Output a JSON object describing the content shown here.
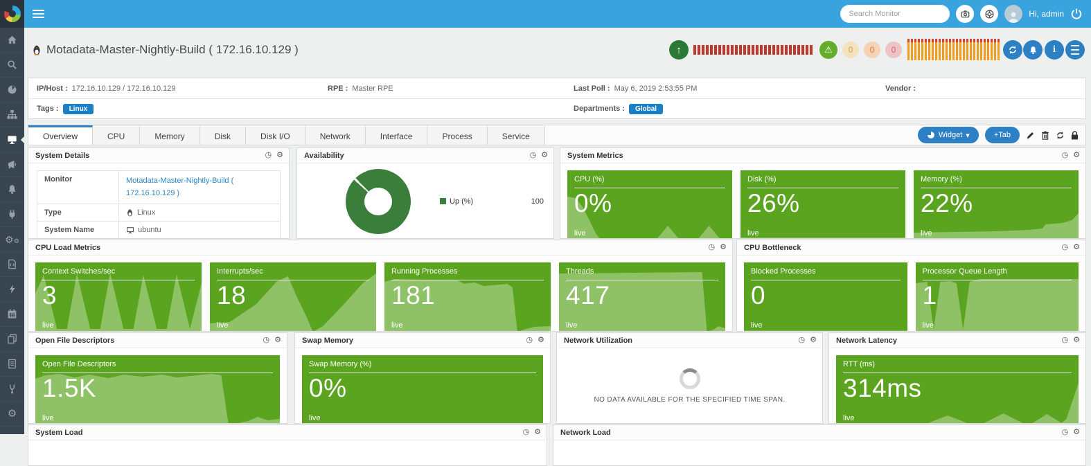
{
  "topbar": {
    "search_placeholder": "Search Monitor",
    "greeting": "Hi, admin"
  },
  "sidebar": {
    "items": [
      "home",
      "search",
      "dashboard",
      "topology",
      "monitor",
      "announcements",
      "alerts",
      "integrations",
      "automation",
      "scripts",
      "actions",
      "scheduler",
      "reports",
      "documents",
      "diagnostics",
      "settings"
    ]
  },
  "header": {
    "title": "Motadata-Master-Nightly-Build ( 172.16.10.129 )",
    "severity_counts": {
      "warning": "0",
      "major": "0",
      "critical": "0"
    }
  },
  "info": {
    "ip_host_label": "IP/Host :",
    "ip_host_value": "172.16.10.129 / 172.16.10.129",
    "rpe_label": "RPE :",
    "rpe_value": "Master RPE",
    "last_poll_label": "Last Poll :",
    "last_poll_value": "May 6, 2019 2:53:55 PM",
    "vendor_label": "Vendor :",
    "vendor_value": "",
    "tags_label": "Tags :",
    "tags": [
      "Linux"
    ],
    "departments_label": "Departments :",
    "departments": [
      "Global"
    ]
  },
  "tabs": {
    "items": [
      "Overview",
      "CPU",
      "Memory",
      "Disk",
      "Disk I/O",
      "Network",
      "Interface",
      "Process",
      "Service"
    ],
    "widget_label": "Widget",
    "add_tab_label": "+Tab"
  },
  "cards": {
    "system_details": {
      "title": "System Details",
      "rows": [
        {
          "label": "Monitor",
          "value": "Motadata-Master-Nightly-Build ( 172.16.10.129 )"
        },
        {
          "label": "Type",
          "value": "Linux"
        },
        {
          "label": "System Name",
          "value": "ubuntu"
        }
      ]
    },
    "availability": {
      "title": "Availability",
      "legend_label": "Up (%)",
      "legend_value": "100"
    },
    "system_metrics": {
      "title": "System Metrics",
      "tiles": [
        {
          "label": "CPU (%)",
          "value": "0%",
          "live": "live"
        },
        {
          "label": "Disk (%)",
          "value": "26%",
          "live": "live"
        },
        {
          "label": "Memory (%)",
          "value": "22%",
          "live": "live"
        }
      ]
    },
    "cpu_load_metrics": {
      "title": "CPU Load Metrics",
      "tiles": [
        {
          "label": "Context Switches/sec",
          "value": "3",
          "live": "live"
        },
        {
          "label": "Interrupts/sec",
          "value": "18",
          "live": "live"
        },
        {
          "label": "Running Processes",
          "value": "181",
          "live": "live"
        },
        {
          "label": "Threads",
          "value": "417",
          "live": "live"
        }
      ]
    },
    "cpu_bottleneck": {
      "title": "CPU Bottleneck",
      "tiles": [
        {
          "label": "Blocked Processes",
          "value": "0",
          "live": "live"
        },
        {
          "label": "Processor Queue Length",
          "value": "1",
          "live": "live"
        }
      ]
    },
    "open_file_descriptors": {
      "title": "Open File Descriptors",
      "tiles": [
        {
          "label": "Open File Descriptors",
          "value": "1.5K",
          "live": "live"
        }
      ]
    },
    "swap_memory": {
      "title": "Swap Memory",
      "tiles": [
        {
          "label": "Swap Memory (%)",
          "value": "0%",
          "live": "live"
        }
      ]
    },
    "network_utilization": {
      "title": "Network Utilization",
      "no_data_message": "NO DATA AVAILABLE FOR THE SPECIFIED TIME SPAN."
    },
    "network_latency": {
      "title": "Network Latency",
      "tiles": [
        {
          "label": "RTT (ms)",
          "value": "314ms",
          "live": "live"
        }
      ]
    },
    "system_load": {
      "title": "System Load"
    },
    "network_load": {
      "title": "Network Load"
    }
  }
}
